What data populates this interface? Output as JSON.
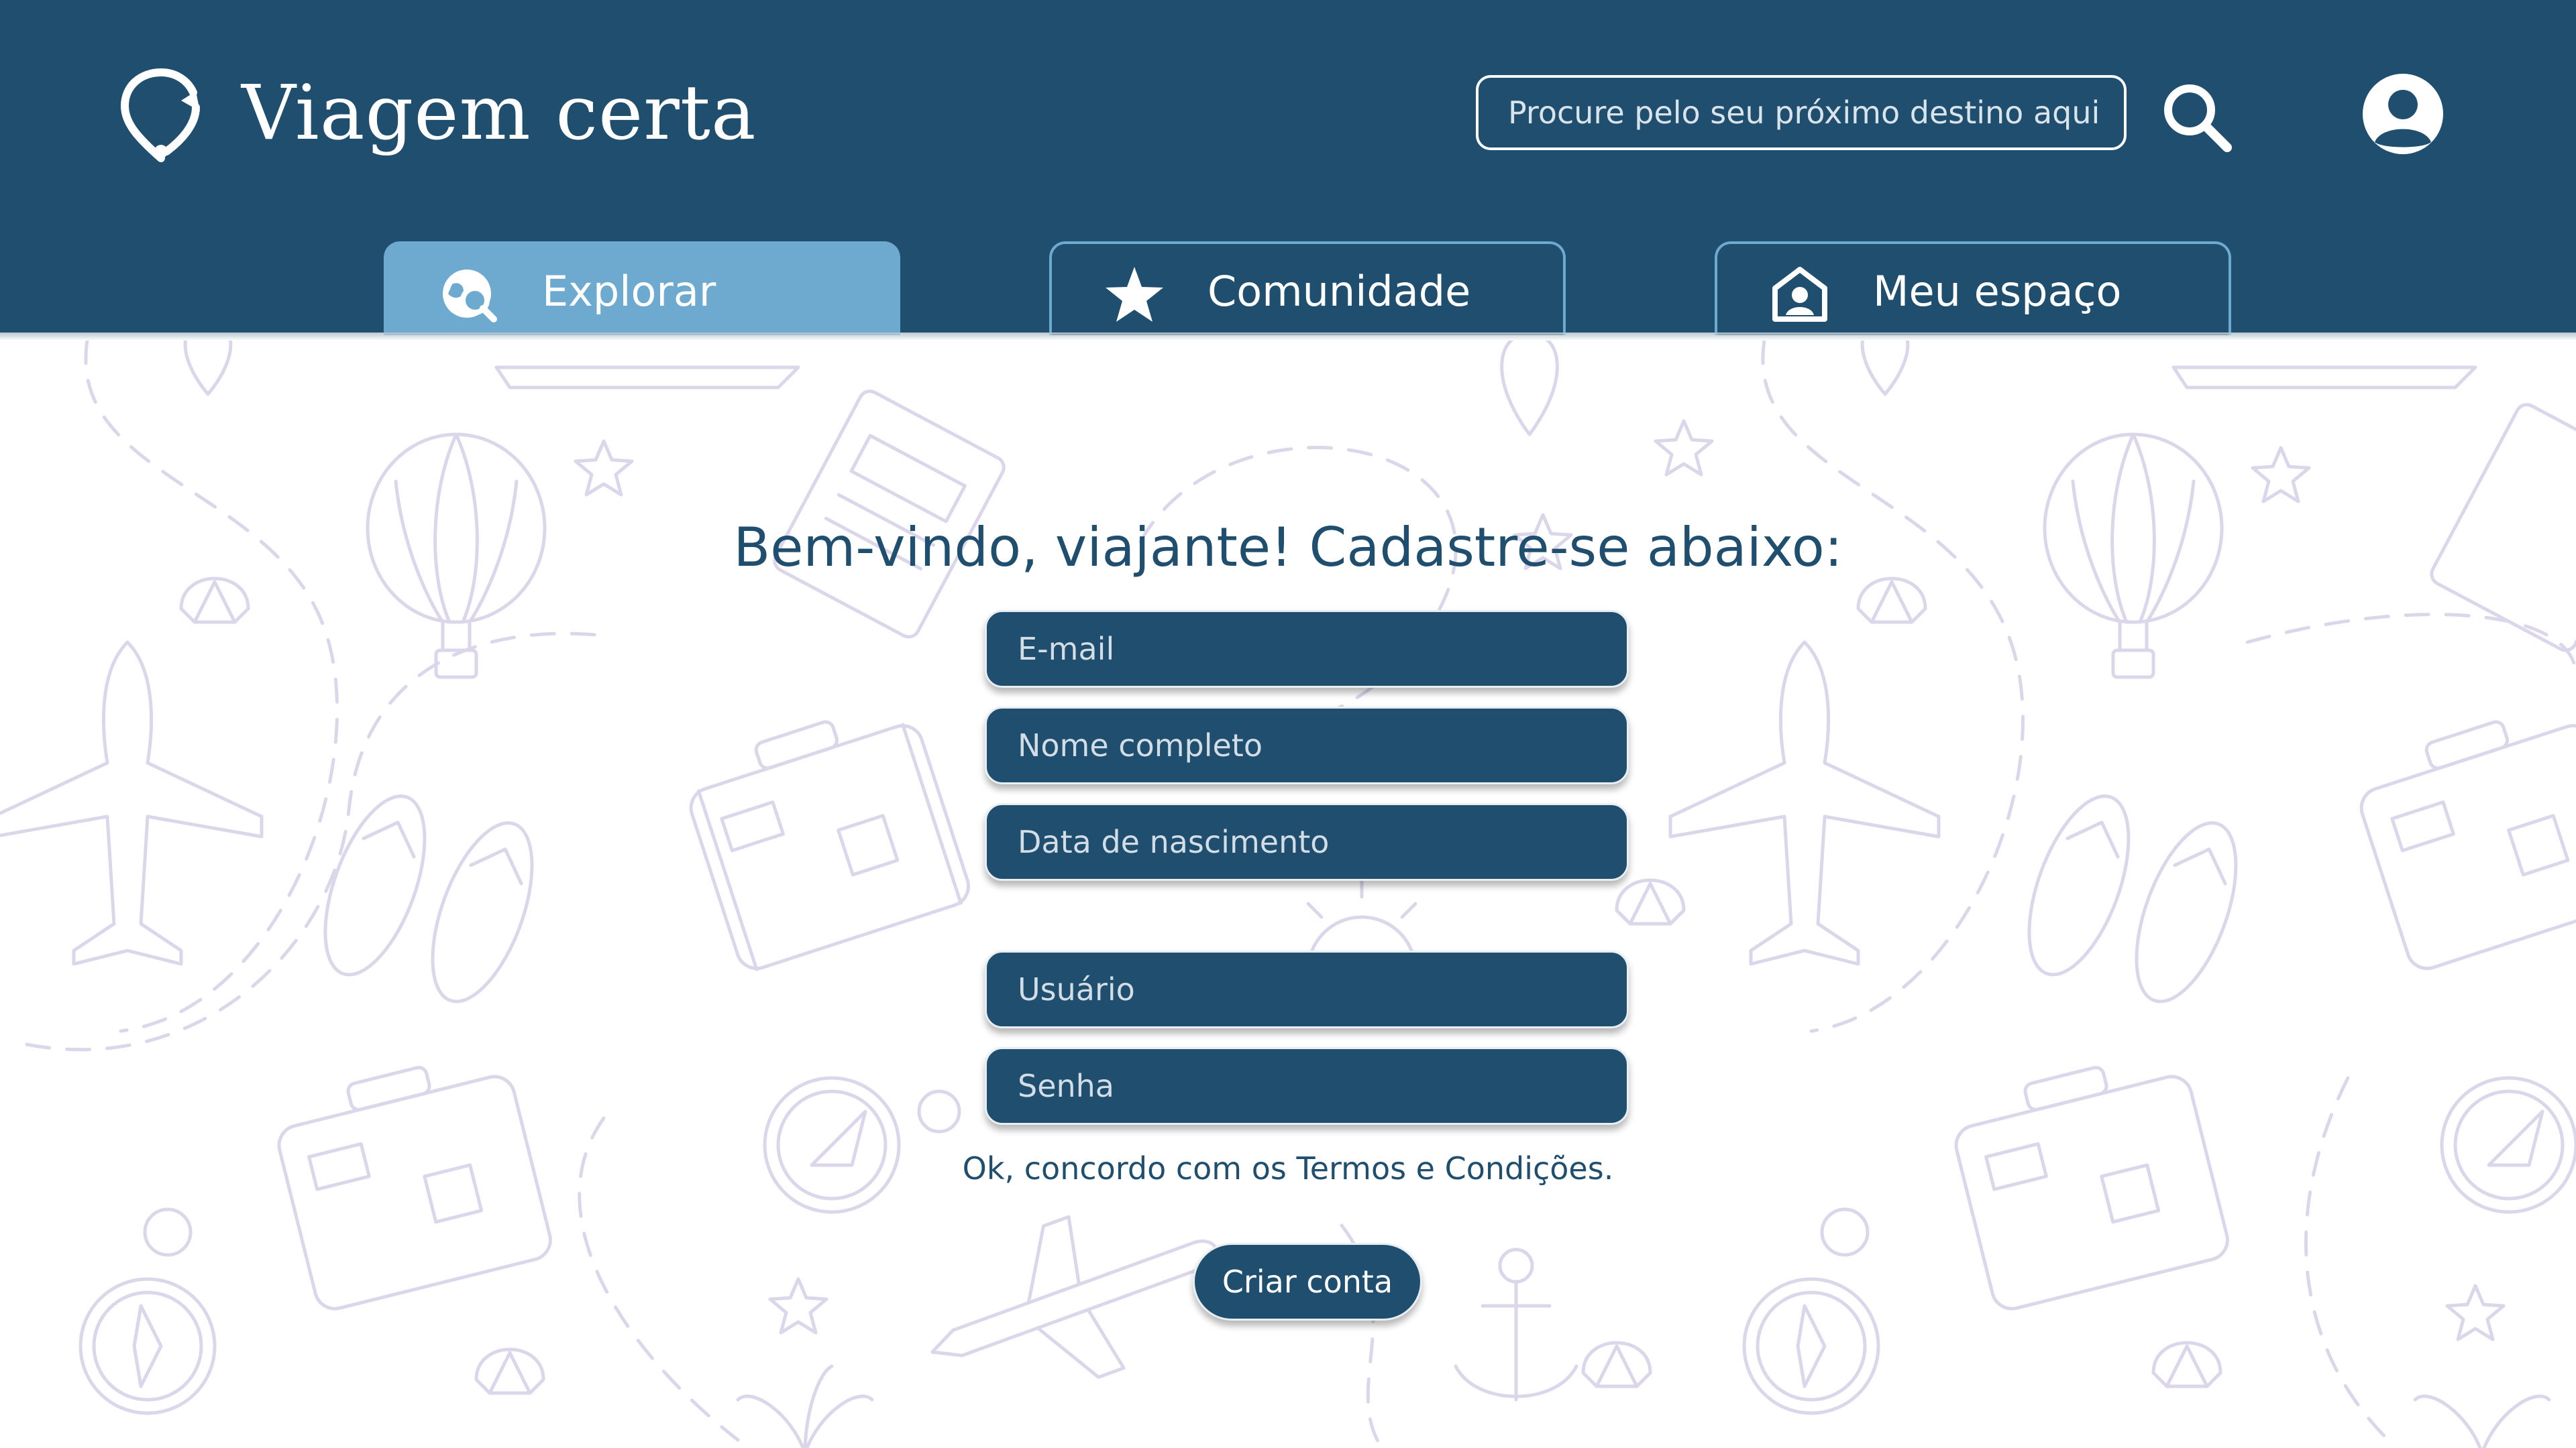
{
  "header": {
    "app_title": "Viagem certa",
    "search_placeholder": "Procure pelo seu próximo destino aqui",
    "logo_icon": "location-refresh-icon",
    "search_icon": "search-icon",
    "profile_icon": "user-circle-icon"
  },
  "tabs": [
    {
      "label": "Explorar",
      "icon": "globe-search-icon",
      "active": true
    },
    {
      "label": "Comunidade",
      "icon": "star-icon",
      "active": false
    },
    {
      "label": "Meu espaço",
      "icon": "home-user-icon",
      "active": false
    }
  ],
  "form": {
    "heading": "Bem-vindo, viajante! Cadastre-se abaixo:",
    "fields": {
      "email": "E-mail",
      "fullname": "Nome completo",
      "birthdate": "Data de nascimento",
      "username": "Usuário",
      "password": "Senha"
    },
    "terms_text": "Ok, concordo com os Termos e Condições.",
    "submit_label": "Criar conta"
  },
  "colors": {
    "primary": "#1f4e6e",
    "tab_active": "#6ea9cf",
    "background": "#ffffff",
    "doodle": "#dcd6ea"
  },
  "background": {
    "pattern": "travel-doodles"
  }
}
